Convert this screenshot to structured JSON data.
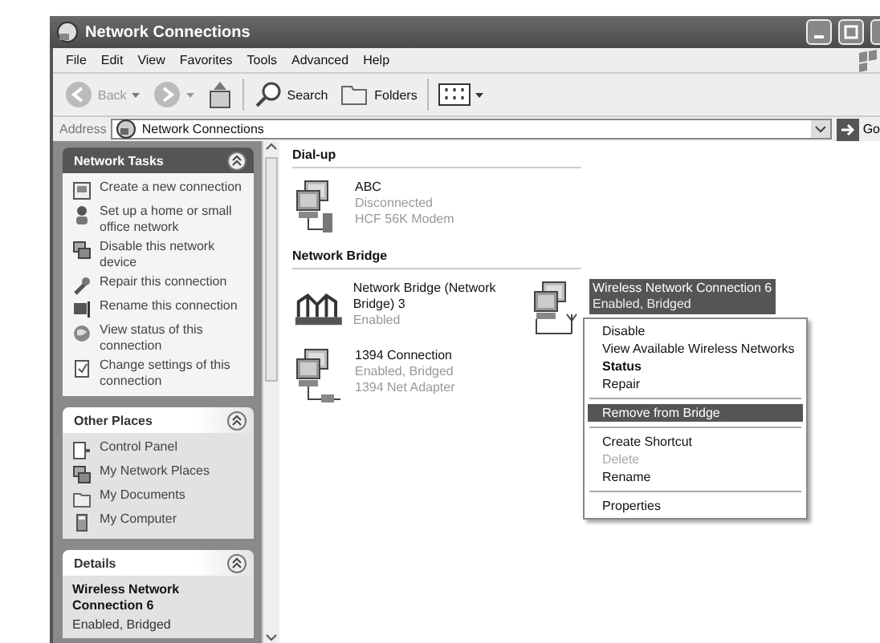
{
  "window": {
    "title": "Network Connections"
  },
  "menu": [
    "File",
    "Edit",
    "View",
    "Favorites",
    "Tools",
    "Advanced",
    "Help"
  ],
  "toolbar": {
    "back": "Back",
    "search": "Search",
    "folders": "Folders"
  },
  "address": {
    "label": "Address",
    "value": "Network Connections",
    "go": "Go"
  },
  "sidebar": [
    {
      "title": "Network Tasks",
      "kind": "tasks",
      "items": [
        "Create a new connection",
        "Set up a home or small office network",
        "Disable this network device",
        "Repair this connection",
        "Rename this connection",
        "View status of this connection",
        "Change settings of this connection"
      ]
    },
    {
      "title": "Other Places",
      "kind": "places",
      "items": [
        "Control Panel",
        "My Network Places",
        "My Documents",
        "My Computer"
      ]
    },
    {
      "title": "Details",
      "kind": "details",
      "name": "Wireless Network Connection 6",
      "status": "Enabled, Bridged"
    }
  ],
  "groups": [
    {
      "title": "Dial-up",
      "connections": [
        {
          "kind": "dialup",
          "name": "ABC",
          "status": "Disconnected",
          "device": "HCF 56K Modem",
          "selected": false
        }
      ]
    },
    {
      "title": "Network Bridge",
      "connections": [
        {
          "kind": "bridge",
          "name": "Network Bridge (Network Bridge) 3",
          "status": "Enabled",
          "selected": false
        },
        {
          "kind": "wireless",
          "name": "Wireless Network Connection 6",
          "status": "Enabled, Bridged",
          "selected": true
        },
        {
          "kind": "lan",
          "name": "1394 Connection",
          "status": "Enabled, Bridged",
          "device": "1394 Net Adapter",
          "selected": false
        }
      ]
    }
  ],
  "context_menu": [
    {
      "kind": "item",
      "label": "Disable",
      "bold": false,
      "disabled": false,
      "selected": false
    },
    {
      "kind": "item",
      "label": "View Available Wireless Networks",
      "bold": false,
      "disabled": false,
      "selected": false
    },
    {
      "kind": "item",
      "label": "Status",
      "bold": true,
      "disabled": false,
      "selected": false
    },
    {
      "kind": "item",
      "label": "Repair",
      "bold": false,
      "disabled": false,
      "selected": false
    },
    {
      "kind": "separator"
    },
    {
      "kind": "item",
      "label": "Remove from Bridge",
      "bold": false,
      "disabled": false,
      "selected": true
    },
    {
      "kind": "separator"
    },
    {
      "kind": "item",
      "label": "Create Shortcut",
      "bold": false,
      "disabled": false,
      "selected": false
    },
    {
      "kind": "item",
      "label": "Delete",
      "bold": false,
      "disabled": true,
      "selected": false
    },
    {
      "kind": "item",
      "label": "Rename",
      "bold": false,
      "disabled": false,
      "selected": false
    },
    {
      "kind": "separator"
    },
    {
      "kind": "item",
      "label": "Properties",
      "bold": false,
      "disabled": false,
      "selected": false
    }
  ]
}
